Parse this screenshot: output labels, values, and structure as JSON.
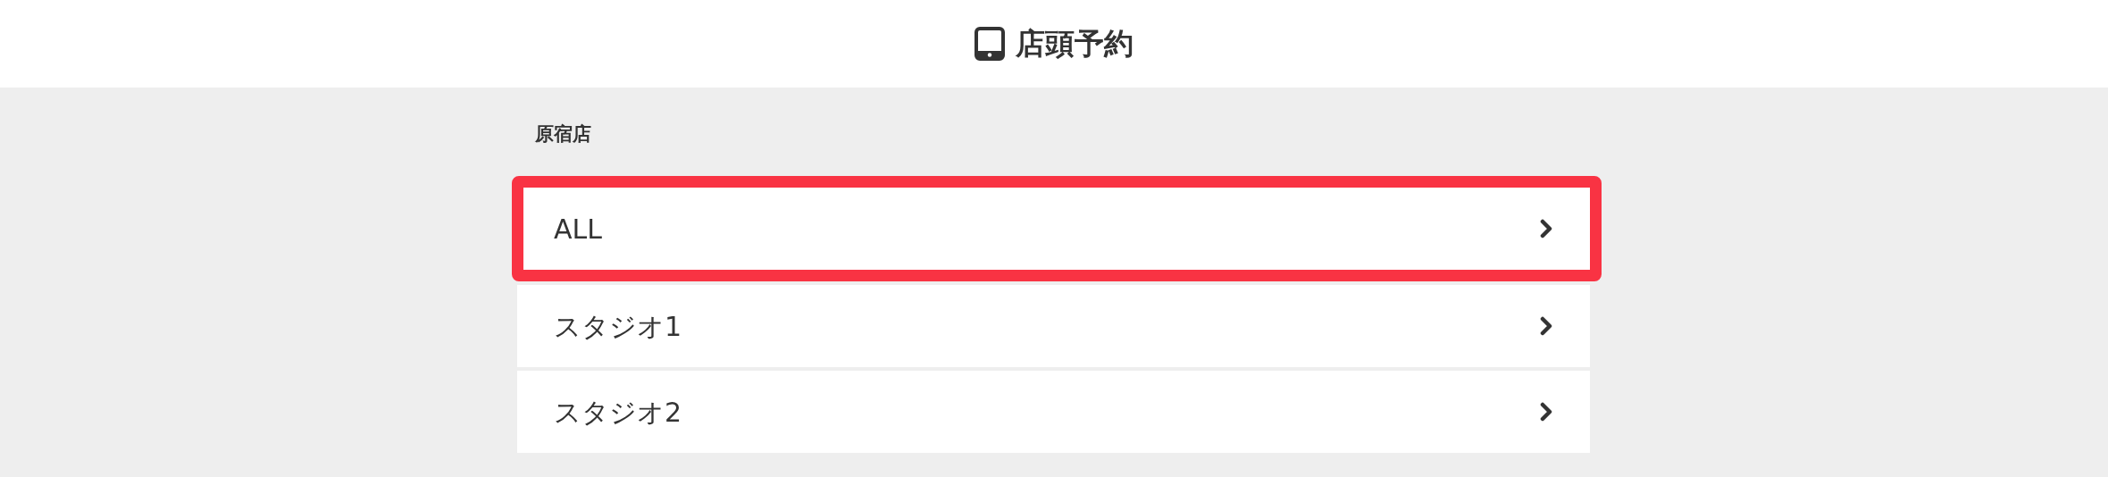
{
  "header": {
    "title": "店頭予約"
  },
  "section": {
    "label": "原宿店"
  },
  "items": [
    {
      "label": "ALL",
      "highlighted": true
    },
    {
      "label": "スタジオ1",
      "highlighted": false
    },
    {
      "label": "スタジオ2",
      "highlighted": false
    }
  ]
}
